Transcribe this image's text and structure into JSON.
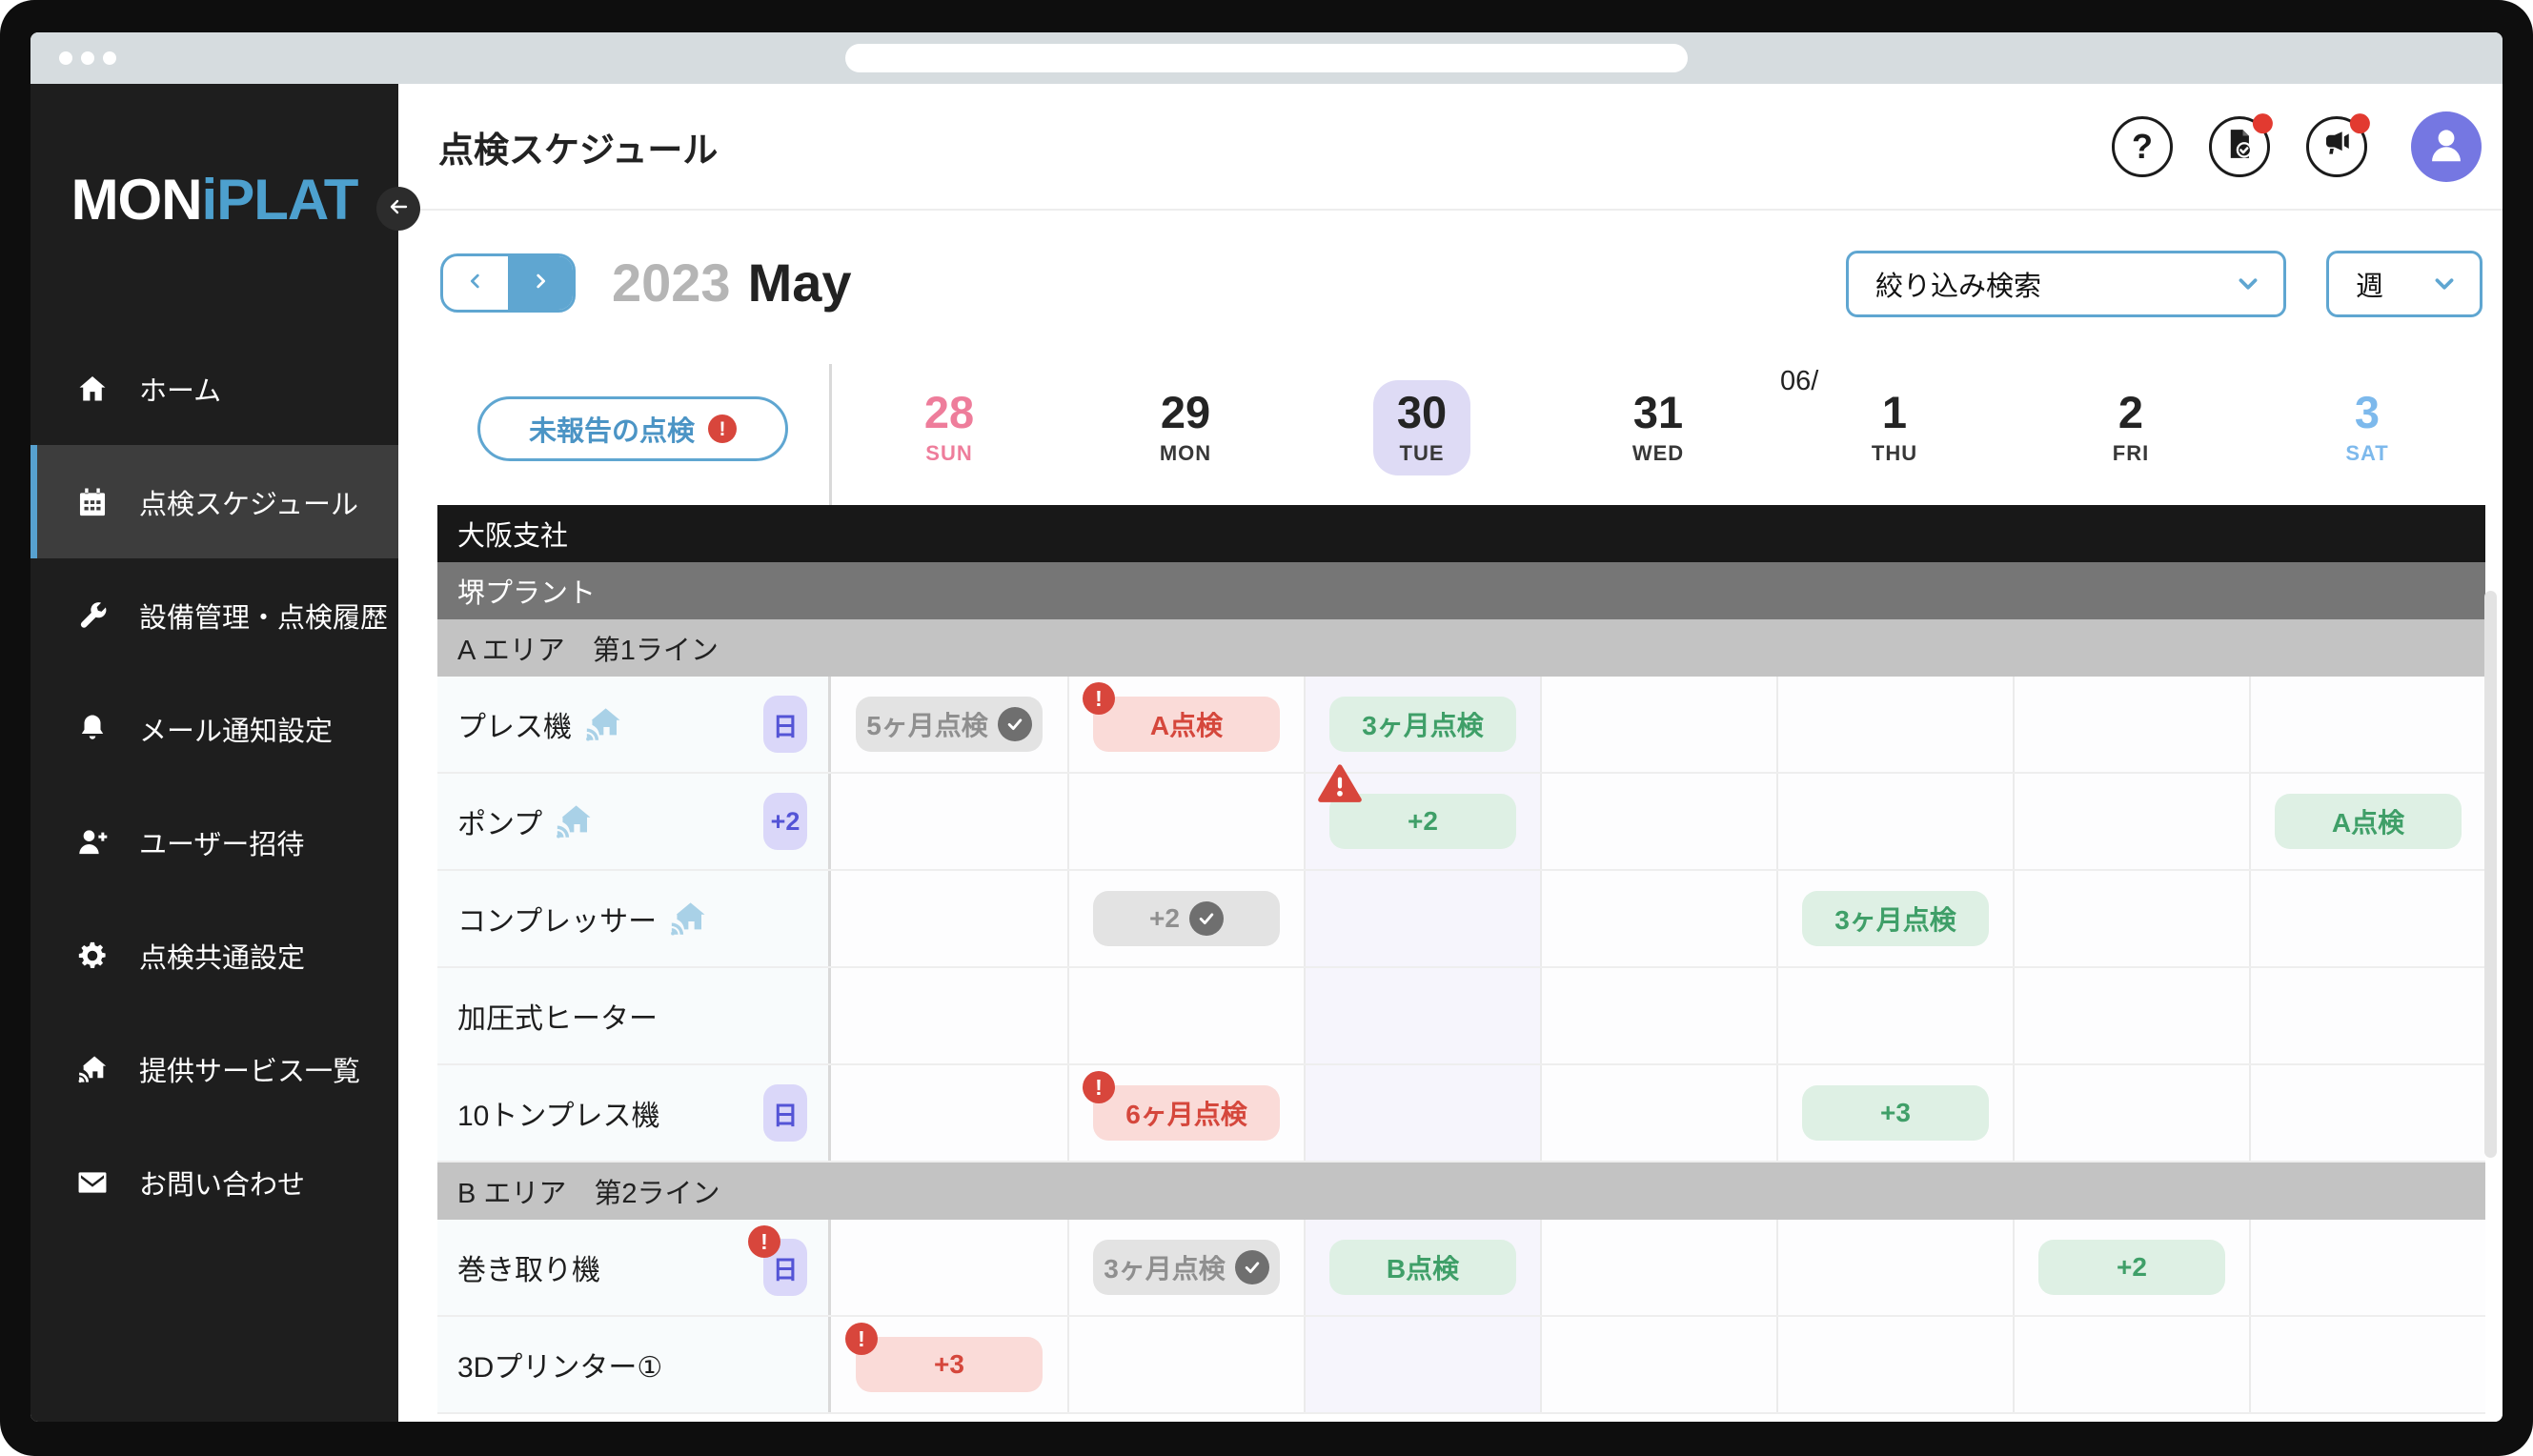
{
  "browser": {
    "address_value": ""
  },
  "sidebar": {
    "logo": {
      "white": "MON",
      "blue": "iPLAT"
    },
    "items": [
      {
        "id": "home",
        "icon": "home",
        "label": "ホーム"
      },
      {
        "id": "inspection-schedule",
        "icon": "calendar",
        "label": "点検スケジュール",
        "active": true
      },
      {
        "id": "equipment-history",
        "icon": "wrench",
        "label": "設備管理・点検履歴"
      },
      {
        "id": "mail-notification",
        "icon": "bell",
        "label": "メール通知設定"
      },
      {
        "id": "user-invite",
        "icon": "user-plus",
        "label": "ユーザー招待"
      },
      {
        "id": "inspection-settings",
        "icon": "gear",
        "label": "点検共通設定"
      },
      {
        "id": "services",
        "icon": "home-signal",
        "label": "提供サービス一覧"
      },
      {
        "id": "contact",
        "icon": "mail",
        "label": "お問い合わせ"
      }
    ]
  },
  "header": {
    "title": "点検スケジュール",
    "help_glyph": "?"
  },
  "toolbar": {
    "year": "2023",
    "month": "May",
    "filter_label": "絞り込み検索",
    "period_label": "週",
    "unreported_label": "未報告の点検",
    "alert_glyph": "!"
  },
  "calendar": {
    "days": [
      {
        "num": "28",
        "dow": "SUN",
        "variant": "sun"
      },
      {
        "num": "29",
        "dow": "MON"
      },
      {
        "num": "30",
        "dow": "TUE",
        "selected": true
      },
      {
        "num": "31",
        "dow": "WED"
      },
      {
        "num": "1",
        "dow": "THU",
        "prefix": "06/"
      },
      {
        "num": "2",
        "dow": "FRI"
      },
      {
        "num": "3",
        "dow": "SAT",
        "variant": "sat"
      }
    ]
  },
  "schedule": {
    "rows": [
      {
        "type": "section",
        "variant": "company",
        "label": "大阪支社"
      },
      {
        "type": "section",
        "variant": "plant",
        "label": "堺プラント"
      },
      {
        "type": "section",
        "variant": "area",
        "label": "A エリア　第1ライン"
      },
      {
        "type": "equipment",
        "name": "プレス機",
        "signal_icon": true,
        "tag": {
          "text": "日"
        },
        "cells": [
          {
            "day": 0,
            "text": "5ヶ月点検",
            "variant": "done",
            "check": true
          },
          {
            "day": 1,
            "text": "A点検",
            "variant": "alert",
            "alert": "circle"
          },
          {
            "day": 2,
            "text": "3ヶ月点検",
            "variant": "ok"
          }
        ]
      },
      {
        "type": "equipment",
        "name": "ポンプ",
        "signal_icon": true,
        "tag": {
          "text": "+2"
        },
        "cells": [
          {
            "day": 2,
            "text": "+2",
            "variant": "ok",
            "alert": "triangle"
          },
          {
            "day": 6,
            "text": "A点検",
            "variant": "ok"
          }
        ]
      },
      {
        "type": "equipment",
        "name": "コンプレッサー",
        "signal_icon": true,
        "cells": [
          {
            "day": 1,
            "text": "+2",
            "variant": "done",
            "check": true
          },
          {
            "day": 4,
            "text": "3ヶ月点検",
            "variant": "ok"
          }
        ]
      },
      {
        "type": "equipment",
        "name": "加圧式ヒーター",
        "cells": []
      },
      {
        "type": "equipment",
        "name": "10トンプレス機",
        "tag": {
          "text": "日"
        },
        "cells": [
          {
            "day": 1,
            "text": "6ヶ月点検",
            "variant": "alert",
            "alert": "circle"
          },
          {
            "day": 4,
            "text": "+3",
            "variant": "ok"
          }
        ]
      },
      {
        "type": "section",
        "variant": "area",
        "label": "B エリア　第2ライン"
      },
      {
        "type": "equipment",
        "name": "巻き取り機",
        "tag": {
          "text": "日",
          "alert": true
        },
        "cells": [
          {
            "day": 1,
            "text": "3ヶ月点検",
            "variant": "done",
            "check": true
          },
          {
            "day": 2,
            "text": "B点検",
            "variant": "ok"
          },
          {
            "day": 5,
            "text": "+2",
            "variant": "ok"
          }
        ]
      },
      {
        "type": "equipment",
        "name": "3Dプリンター①",
        "cells": [
          {
            "day": 0,
            "text": "+3",
            "variant": "alert",
            "alert": "circle"
          }
        ]
      }
    ]
  },
  "colors": {
    "accent_blue": "#5fa6d1",
    "logo_blue": "#4da0ce",
    "alert_red": "#d8463c",
    "ok_green": "#3f9f68",
    "done_gray": "#8f8f8f",
    "tag_purple": "#5454d6",
    "selected_day_bg": "#dedbf5",
    "sunday_pink": "#ee7d9b",
    "saturday_blue": "#7db9ec",
    "avatar_purple": "#7577e2"
  }
}
